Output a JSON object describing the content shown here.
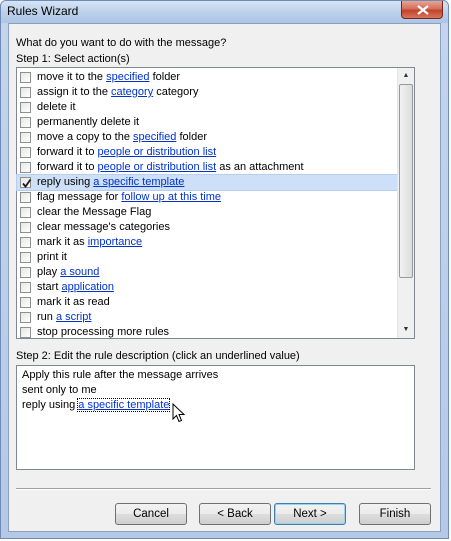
{
  "window": {
    "title": "Rules Wizard"
  },
  "prompt": "What do you want to do with the message?",
  "step1": {
    "label": "Step 1: Select action(s)"
  },
  "actions": [
    {
      "before": "move it to the ",
      "link": "specified",
      "after": " folder",
      "checked": false
    },
    {
      "before": "assign it to the ",
      "link": "category",
      "after": " category",
      "checked": false
    },
    {
      "before": "delete it",
      "link": "",
      "after": "",
      "checked": false
    },
    {
      "before": "permanently delete it",
      "link": "",
      "after": "",
      "checked": false
    },
    {
      "before": "move a copy to the ",
      "link": "specified",
      "after": " folder",
      "checked": false
    },
    {
      "before": "forward it to ",
      "link": "people or distribution list",
      "after": "",
      "checked": false
    },
    {
      "before": "forward it to ",
      "link": "people or distribution list",
      "after": " as an attachment",
      "checked": false
    },
    {
      "before": "reply using ",
      "link": "a specific template",
      "after": "",
      "checked": true
    },
    {
      "before": "flag message for ",
      "link": "follow up at this time",
      "after": "",
      "checked": false
    },
    {
      "before": "clear the Message Flag",
      "link": "",
      "after": "",
      "checked": false
    },
    {
      "before": "clear message's categories",
      "link": "",
      "after": "",
      "checked": false
    },
    {
      "before": "mark it as ",
      "link": "importance",
      "after": "",
      "checked": false
    },
    {
      "before": "print it",
      "link": "",
      "after": "",
      "checked": false
    },
    {
      "before": "play ",
      "link": "a sound",
      "after": "",
      "checked": false
    },
    {
      "before": "start ",
      "link": "application",
      "after": "",
      "checked": false
    },
    {
      "before": "mark it as read",
      "link": "",
      "after": "",
      "checked": false
    },
    {
      "before": "run ",
      "link": "a script",
      "after": "",
      "checked": false
    },
    {
      "before": "stop processing more rules",
      "link": "",
      "after": "",
      "checked": false
    }
  ],
  "step2": {
    "label": "Step 2: Edit the rule description (click an underlined value)",
    "line1": "Apply this rule after the message arrives",
    "line2": "sent only to me",
    "line3_before": "reply using ",
    "line3_link": "a specific template"
  },
  "buttons": {
    "cancel": "Cancel",
    "back": "< Back",
    "next": "Next >",
    "finish": "Finish"
  }
}
